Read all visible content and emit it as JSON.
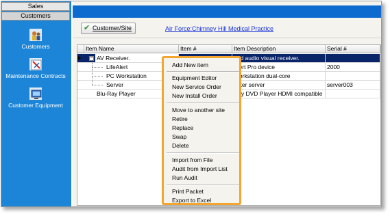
{
  "nav": {
    "tab_sales": "Sales",
    "tab_customers": "Customers",
    "items": [
      {
        "label": "Customers",
        "icon": "customers-icon"
      },
      {
        "label": "Maintenance Contracts",
        "icon": "maintenance-contracts-icon"
      },
      {
        "label": "Customer Equipment",
        "icon": "customer-equipment-icon"
      }
    ]
  },
  "toolbar": {
    "customer_site_button": "Customer/Site",
    "site_link": "Air Force:Chimney Hill Medical  Practice"
  },
  "grid": {
    "columns": [
      "Item Name",
      "Item #",
      "Item Description",
      "Serial #"
    ],
    "rows": [
      {
        "name": "AV Receiver.",
        "item_no": "",
        "description": "end audio visual receiver.",
        "serial": ""
      },
      {
        "name": "LifeAlert",
        "item_no": "",
        "description": "Alert Pro device",
        "serial": "2000"
      },
      {
        "name": "PC Workstation",
        "item_no": "",
        "description": "Workstation dual-core",
        "serial": ""
      },
      {
        "name": "Server",
        "item_no": "",
        "description": "outer server",
        "serial": "server003"
      },
      {
        "name": "Blu-Ray Player",
        "item_no": "",
        "description": "Ray DVD Player HDMI compatible",
        "serial": ""
      }
    ]
  },
  "context_menu": {
    "groups": [
      [
        "Add New item"
      ],
      [
        "Equipment Editor",
        "New Service Order",
        "New Install Order"
      ],
      [
        "Move to another site",
        "Retire",
        "Replace",
        "Swap",
        "Delete"
      ],
      [
        "Import from File",
        "Audit from Import List",
        "Run Audit"
      ],
      [
        "Print Packet",
        "Export to Excel"
      ]
    ]
  },
  "colors": {
    "nav_background": "#1d85d7",
    "title_bar": "#0d6bcf",
    "selection": "#0a246a",
    "menu_highlight_border": "#f3a52f",
    "link": "#1530d8"
  }
}
